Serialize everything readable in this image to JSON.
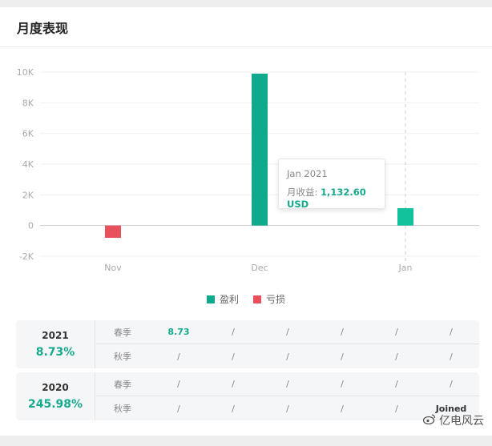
{
  "card": {
    "title": "月度表现"
  },
  "chart_data": {
    "type": "bar",
    "categories": [
      "Nov",
      "Dec",
      "Jan"
    ],
    "values": [
      -800,
      9900,
      1132.6
    ],
    "ylim": [
      -2000,
      10000
    ],
    "yticks": [
      10000,
      8000,
      6000,
      4000,
      2000,
      0,
      -2000
    ],
    "ytick_labels": [
      "10K",
      "8K",
      "6K",
      "4K",
      "2K",
      "0",
      "-2K"
    ],
    "grid": true,
    "legend": {
      "position": "bottom",
      "entries": [
        {
          "label": "盈利",
          "color": "#0fa98e"
        },
        {
          "label": "亏损",
          "color": "#e8505b"
        }
      ]
    },
    "colors": {
      "profit": "#0fa98e",
      "loss": "#e8505b",
      "highlight_profit": "#12c29d"
    },
    "highlight_category": "Jan"
  },
  "tooltip": {
    "title": "Jan 2021",
    "label": "月收益:",
    "value": "1,132.60 USD"
  },
  "years": [
    {
      "year": "2021",
      "return": "8.73%",
      "rows": [
        {
          "label": "春季",
          "cells": [
            "8.73",
            "/",
            "/",
            "/",
            "/",
            "/"
          ]
        },
        {
          "label": "秋季",
          "cells": [
            "/",
            "/",
            "/",
            "/",
            "/",
            "/"
          ]
        }
      ]
    },
    {
      "year": "2020",
      "return": "245.98%",
      "rows": [
        {
          "label": "春季",
          "cells": [
            "/",
            "/",
            "/",
            "/",
            "/",
            "/"
          ]
        },
        {
          "label": "秋季",
          "cells": [
            "/",
            "/",
            "/",
            "/",
            "/",
            "Joined"
          ]
        }
      ]
    }
  ],
  "watermark": {
    "text": "亿电风云",
    "icon": "weibo-icon"
  }
}
